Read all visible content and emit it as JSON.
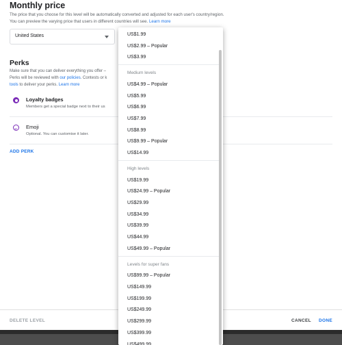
{
  "monthly_price": {
    "title": "Monthly price",
    "description": "The price that you choose for this level will be automatically converted and adjusted for each user's country/region. You can preview the varying price that users in different countries will see.",
    "learn_more": "Learn more"
  },
  "country": {
    "selected": "United States"
  },
  "perks": {
    "title": "Perks",
    "description_line1": "Make sure that you can deliver everything you offer –",
    "description_line2a": "Perks will be reviewed with ",
    "description_line2_link": "our policies",
    "description_line2b": ". Contests or k",
    "description_line3_link": "tools",
    "description_line3b": " to deliver your perks. ",
    "description_line3_learn": "Learn more",
    "items": [
      {
        "name": "Loyalty badges",
        "sub": "Members get a special badge next to their us",
        "icon": "badge-icon"
      },
      {
        "name": "Emoji",
        "sub": "Optional. You can customise it later.",
        "icon": "emoji-icon"
      }
    ],
    "add_label": "ADD PERK"
  },
  "dropdown": {
    "groups": [
      {
        "header": "",
        "items": [
          "US$1.99",
          "US$2.99 – Popular",
          "US$3.99"
        ]
      },
      {
        "header": "Medium levels",
        "items": [
          "US$4.99 – Popular",
          "US$5.99",
          "US$6.99",
          "US$7.99",
          "US$8.99",
          "US$9.99 – Popular",
          "US$14.99"
        ]
      },
      {
        "header": "High levels",
        "items": [
          "US$19.99",
          "US$24.99 – Popular",
          "US$29.99",
          "US$34.99",
          "US$39.99",
          "US$44.99",
          "US$49.99 – Popular"
        ]
      },
      {
        "header": "Levels for super fans",
        "items": [
          "US$99.99 – Popular",
          "US$149.99",
          "US$199.99",
          "US$249.99",
          "US$299.99",
          "US$399.99",
          "US$499.99"
        ]
      }
    ]
  },
  "footer": {
    "delete_label": "DELETE LEVEL",
    "cancel_label": "CANCEL",
    "done_label": "DONE"
  },
  "colors": {
    "accent": "#1a73e8",
    "perk_icon": "#7b2cb8"
  }
}
